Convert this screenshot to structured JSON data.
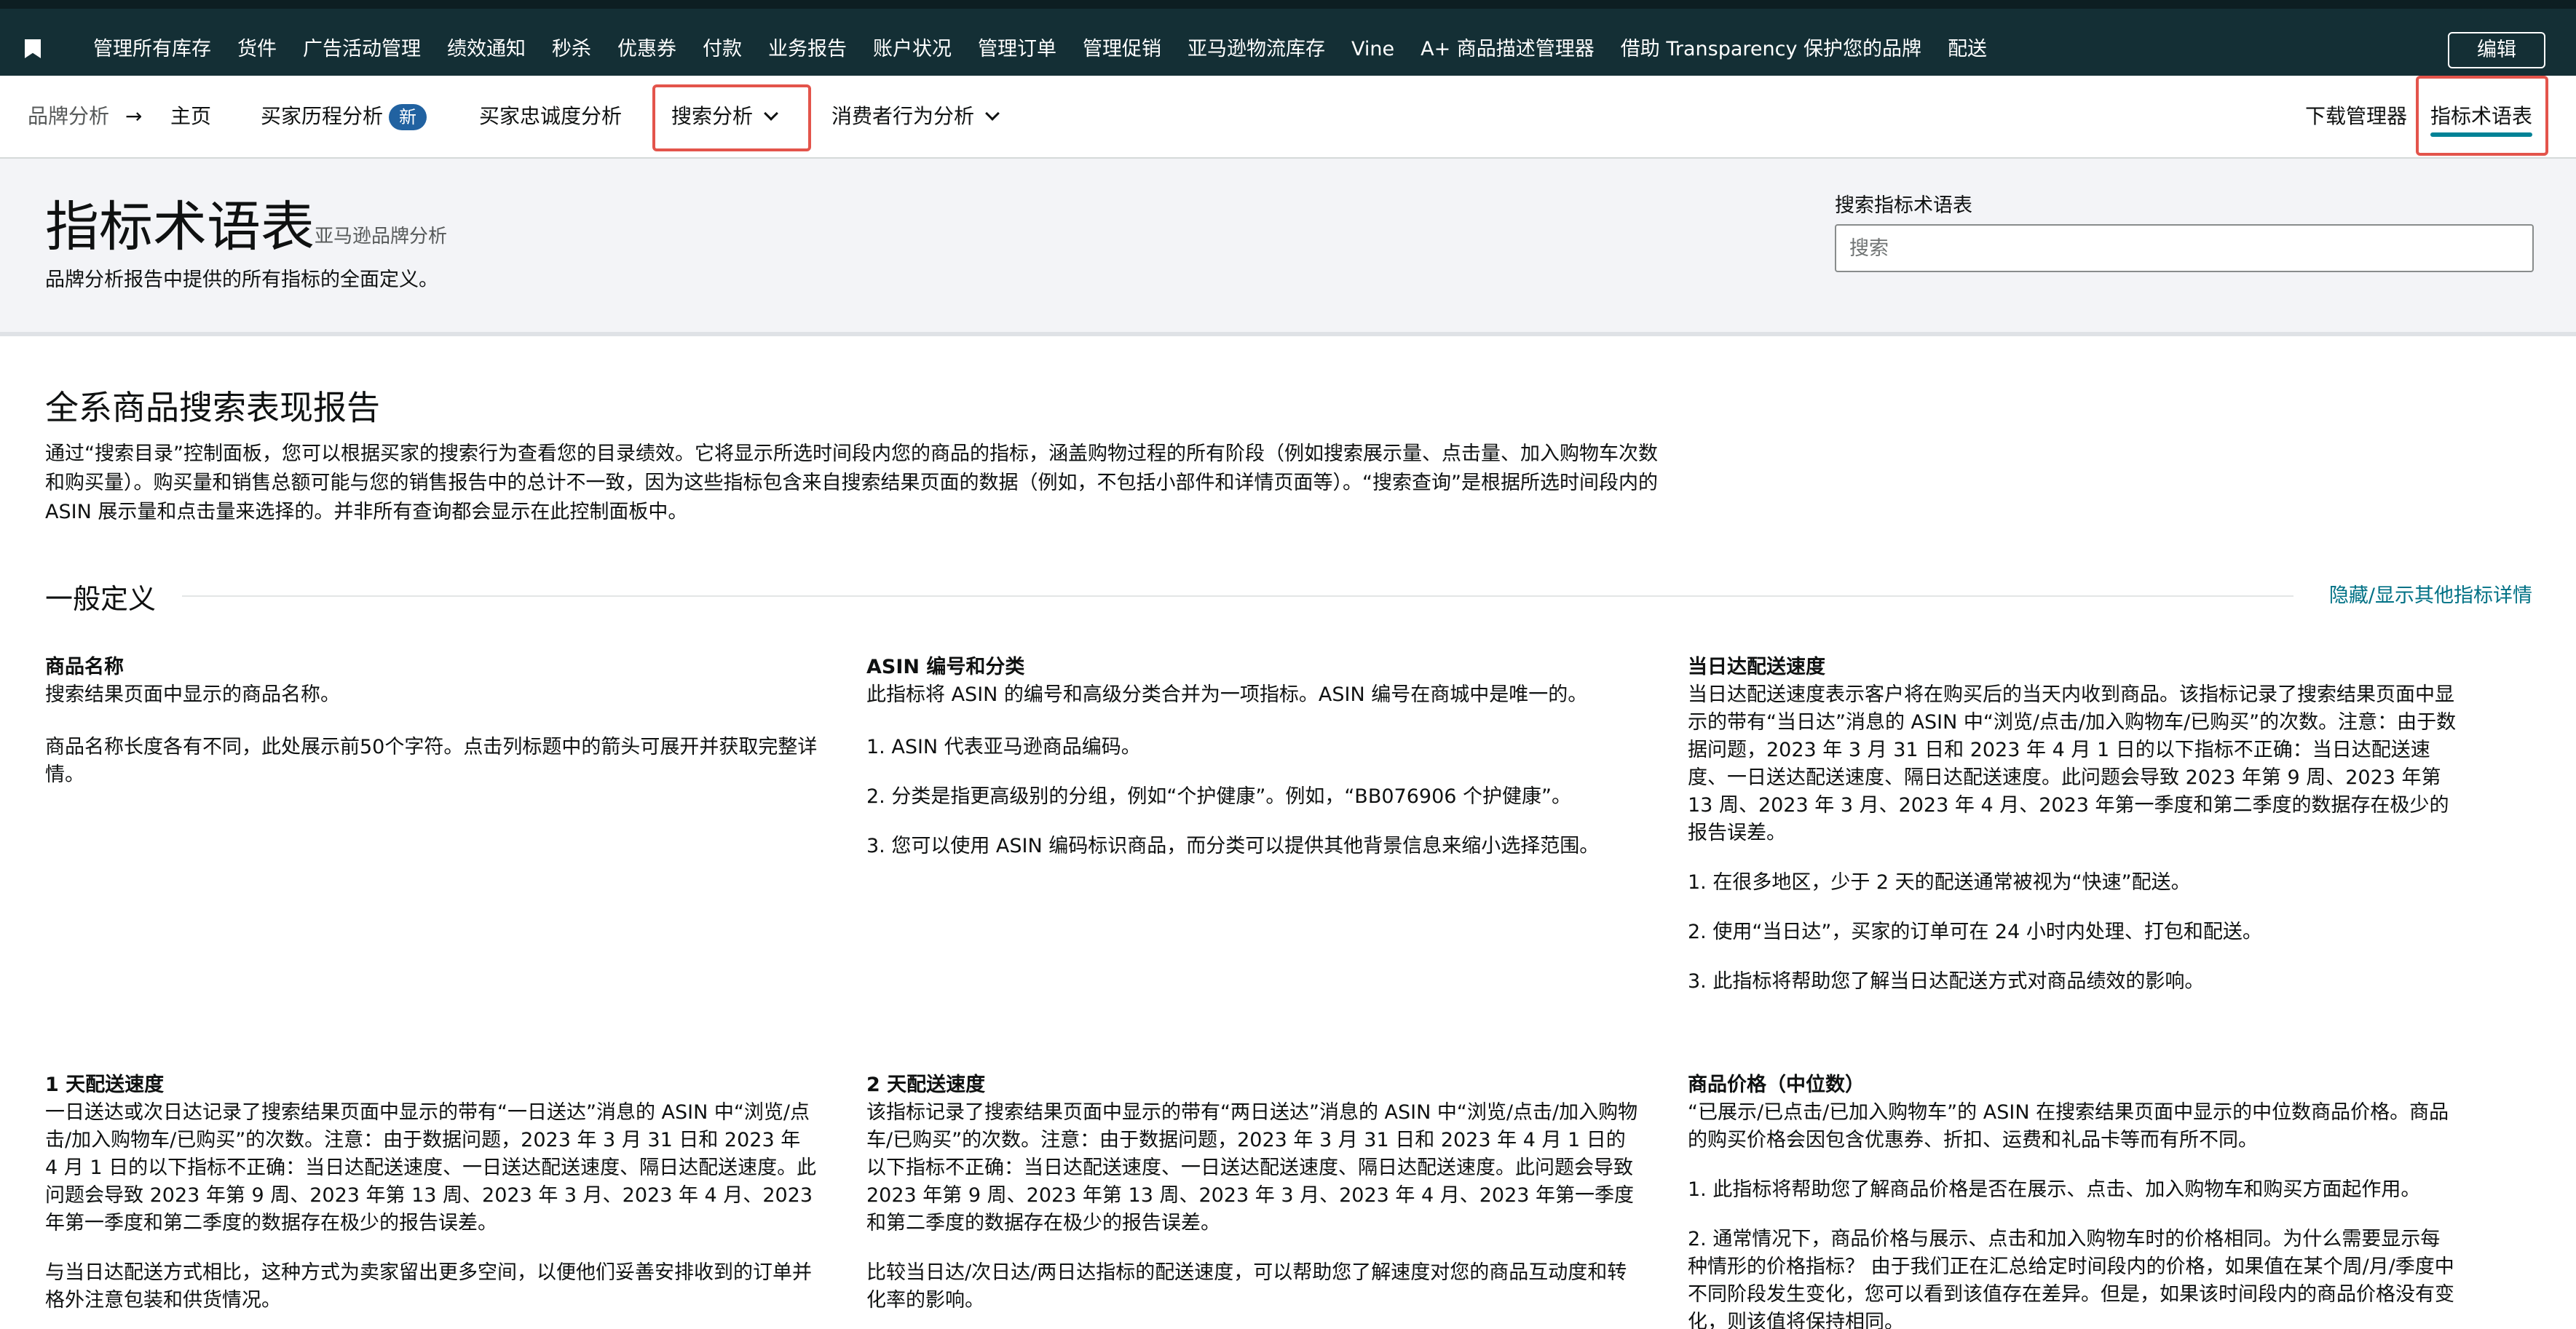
{
  "topnav": {
    "items": [
      "管理所有库存",
      "货件",
      "广告活动管理",
      "绩效通知",
      "秒杀",
      "优惠券",
      "付款",
      "业务报告",
      "账户状况",
      "管理订单",
      "管理促销",
      "亚马逊物流库存",
      "Vine",
      "A+ 商品描述管理器",
      "借助 Transparency 保护您的品牌",
      "配送"
    ],
    "edit_label": "编辑"
  },
  "subnav": {
    "breadcrumb_root": "品牌分析",
    "home": "主页",
    "buyer_journey": "买家历程分析",
    "new_badge": "新",
    "loyalty": "买家忠诚度分析",
    "search_analysis": "搜索分析",
    "consumer_behavior": "消费者行为分析",
    "download_manager": "下载管理器",
    "glossary": "指标术语表",
    "highlight_color": "#e3544b",
    "active_underline_color": "#008296"
  },
  "hero": {
    "title": "指标术语表",
    "subtitle": "亚马逊品牌分析",
    "description": "品牌分析报告中提供的所有指标的全面定义。",
    "search_label": "搜索指标术语表",
    "search_placeholder": "搜索"
  },
  "section": {
    "title": "全系商品搜索表现报告",
    "intro": "通过“搜索目录”控制面板，您可以根据买家的搜索行为查看您的目录绩效。它将显示所选时间段内您的商品的指标，涵盖购物过程的所有阶段（例如搜索展示量、点击量、加入购物车次数和购买量）。购买量和销售总额可能与您的销售报告中的总计不一致，因为这些指标包含来自搜索结果页面的数据（例如，不包括小部件和详情页面等）。“搜索查询”是根据所选时间段内的 ASIN 展示量和点击量来选择的。并非所有查询都会显示在此控制面板中。",
    "general_defs": "一般定义",
    "toggle_link": "隐藏/显示其他指标详情"
  },
  "terms": [
    {
      "name": "商品名称",
      "paragraphs": [
        "搜索结果页面中显示的商品名称。",
        "商品名称长度各有不同，此处展示前50个字符。点击列标题中的箭头可展开并获取完整详情。"
      ]
    },
    {
      "name": "ASIN 编号和分类",
      "paragraphs": [
        "此指标将 ASIN 的编号和高级分类合并为一项指标。ASIN 编号在商城中是唯一的。",
        "1. ASIN 代表亚马逊商品编码。",
        "2. 分类是指更高级别的分组，例如“个护健康”。例如，“BB076906 个护健康”。",
        "3. 您可以使用 ASIN 编码标识商品，而分类可以提供其他背景信息来缩小选择范围。"
      ]
    },
    {
      "name": "当日达配送速度",
      "paragraphs": [
        "当日达配送速度表示客户将在购买后的当天内收到商品。该指标记录了搜索结果页面中显示的带有“当日达”消息的 ASIN 中“浏览/点击/加入购物车/已购买”的次数。注意：由于数据问题，2023 年 3 月 31 日和 2023 年 4 月 1 日的以下指标不正确：当日达配送速度、一日送达配送速度、隔日达配送速度。此问题会导致 2023 年第 9 周、2023 年第 13 周、2023 年 3 月、2023 年 4 月、2023 年第一季度和第二季度的数据存在极少的报告误差。",
        "1. 在很多地区，少于 2 天的配送通常被视为“快速”配送。",
        "2. 使用“当日达”，买家的订单可在 24 小时内处理、打包和配送。",
        "3. 此指标将帮助您了解当日达配送方式对商品绩效的影响。"
      ]
    },
    {
      "name": "1 天配送速度",
      "paragraphs": [
        "一日送达或次日达记录了搜索结果页面中显示的带有“一日送达”消息的 ASIN 中“浏览/点击/加入购物车/已购买”的次数。注意：由于数据问题，2023 年 3 月 31 日和 2023 年 4 月 1 日的以下指标不正确：当日达配送速度、一日送达配送速度、隔日达配送速度。此问题会导致 2023 年第 9 周、2023 年第 13 周、2023 年 3 月、2023 年 4 月、2023 年第一季度和第二季度的数据存在极少的报告误差。",
        "与当日达配送方式相比，这种方式为卖家留出更多空间，以便他们妥善安排收到的订单并格外注意包装和供货情况。"
      ]
    },
    {
      "name": "2 天配送速度",
      "paragraphs": [
        "该指标记录了搜索结果页面中显示的带有“两日送达”消息的 ASIN 中“浏览/点击/加入购物车/已购买”的次数。注意：由于数据问题，2023 年 3 月 31 日和 2023 年 4 月 1 日的以下指标不正确：当日达配送速度、一日送达配送速度、隔日达配送速度。此问题会导致 2023 年第 9 周、2023 年第 13 周、2023 年 3 月、2023 年 4 月、2023 年第一季度和第二季度的数据存在极少的报告误差。",
        "比较当日达/次日达/两日达指标的配送速度，可以帮助您了解速度对您的商品互动度和转化率的影响。"
      ]
    },
    {
      "name": "商品价格（中位数）",
      "paragraphs": [
        "“已展示/已点击/已加入购物车”的 ASIN 在搜索结果页面中显示的中位数商品价格。商品的购买价格会因包含优惠券、折扣、运费和礼品卡等而有所不同。",
        "1. 此指标将帮助您了解商品价格是否在展示、点击、加入购物车和购买方面起作用。",
        "2. 通常情况下，商品价格与展示、点击和加入购物车时的价格相同。为什么需要显示每种情形的价格指标？ 由于我们正在汇总给定时间段内的价格，如果值在某个周/月/季度中不同阶段发生变化，您可以看到该值存在差异。但是，如果该时间段内的商品价格没有变化，则该值将保持相同。"
      ]
    }
  ]
}
